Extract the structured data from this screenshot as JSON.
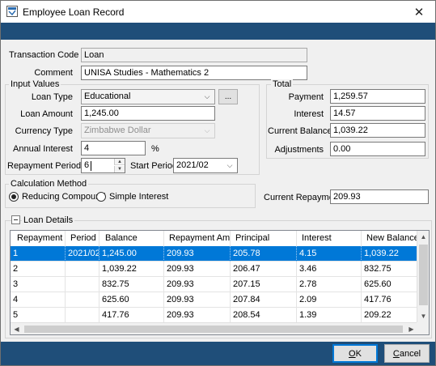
{
  "window": {
    "title": "Employee Loan Record",
    "close_glyph": "✕"
  },
  "fields": {
    "transaction_code": {
      "label": "Transaction Code",
      "value": "Loan"
    },
    "comment": {
      "label": "Comment",
      "value": "UNISA Studies - Mathematics 2"
    }
  },
  "input_values": {
    "title": "Input Values",
    "loan_type": {
      "label": "Loan Type",
      "value": "Educational",
      "button": "..."
    },
    "loan_amount": {
      "label": "Loan Amount",
      "value": "1,245.00"
    },
    "currency_type": {
      "label": "Currency Type",
      "value": "Zimbabwe Dollar"
    },
    "annual_interest": {
      "label": "Annual Interest",
      "value": "4",
      "unit": "%"
    },
    "repayment_periods": {
      "label": "Repayment Periods",
      "value": "6"
    },
    "start_period": {
      "label": "Start Period",
      "value": "2021/02"
    }
  },
  "total": {
    "title": "Total",
    "payment": {
      "label": "Payment",
      "value": "1,259.57"
    },
    "interest": {
      "label": "Interest",
      "value": "14.57"
    },
    "current_balance": {
      "label": "Current Balance",
      "value": "1,039.22"
    },
    "adjustments": {
      "label": "Adjustments",
      "value": "0.00"
    }
  },
  "calculation_method": {
    "title": "Calculation Method",
    "options": [
      "Reducing Compound",
      "Simple Interest"
    ],
    "selected": "Reducing Compound"
  },
  "current_repayment": {
    "label": "Current Repayment",
    "value": "209.93"
  },
  "loan_details": {
    "title": "Loan Details",
    "columns": [
      "Repayment #",
      "Period",
      "Balance",
      "Repayment Amnt",
      "Principal",
      "Interest",
      "New Balance"
    ],
    "rows": [
      [
        "1",
        "2021/02",
        "1,245.00",
        "209.93",
        "205.78",
        "4.15",
        "1,039.22"
      ],
      [
        "2",
        "",
        "1,039.22",
        "209.93",
        "206.47",
        "3.46",
        "832.75"
      ],
      [
        "3",
        "",
        "832.75",
        "209.93",
        "207.15",
        "2.78",
        "625.60"
      ],
      [
        "4",
        "",
        "625.60",
        "209.93",
        "207.84",
        "2.09",
        "417.76"
      ],
      [
        "5",
        "",
        "417.76",
        "209.93",
        "208.54",
        "1.39",
        "209.22"
      ]
    ],
    "selected_row": 0
  },
  "buttons": {
    "ok": "OK",
    "ok_accel": "O",
    "ok_rest": "K",
    "cancel": "Cancel",
    "cancel_accel": "C",
    "cancel_rest": "ancel"
  },
  "colors": {
    "band": "#1f4e79",
    "selection": "#0078d7",
    "dialog_bg": "#f0f0f0"
  }
}
